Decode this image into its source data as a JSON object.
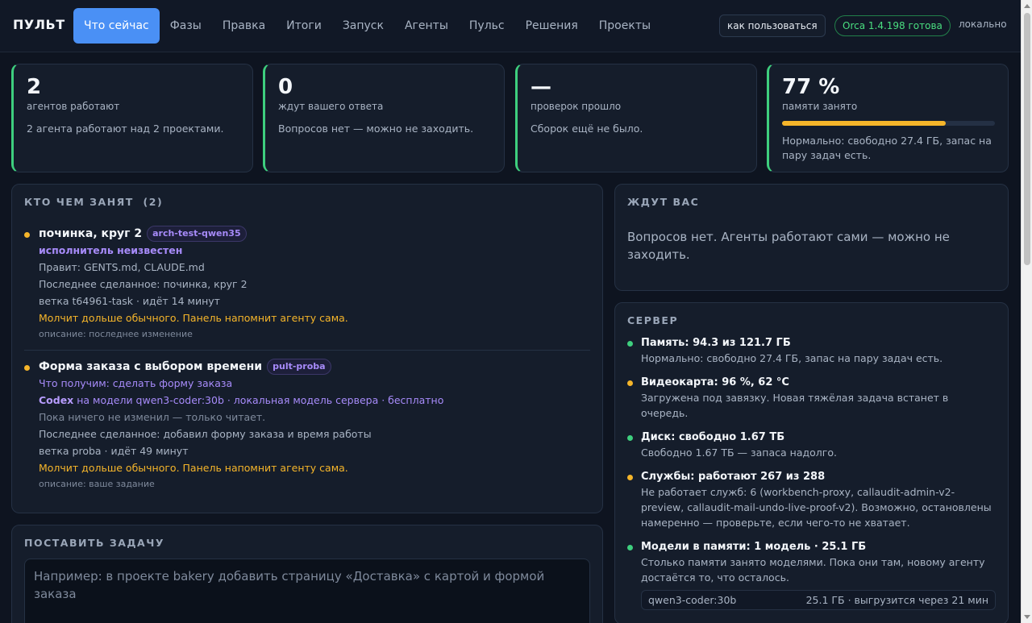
{
  "app": {
    "brand": "ПУЛЬТ"
  },
  "nav": {
    "tabs": [
      {
        "label": "Что сейчас",
        "active": true
      },
      {
        "label": "Фазы"
      },
      {
        "label": "Правка"
      },
      {
        "label": "Итоги"
      },
      {
        "label": "Запуск"
      },
      {
        "label": "Агенты"
      },
      {
        "label": "Пульс"
      },
      {
        "label": "Решения"
      },
      {
        "label": "Проекты"
      }
    ]
  },
  "header": {
    "help_label": "как пользоваться",
    "status_label": "Orca 1.4.198 готова",
    "mode_label": "локально"
  },
  "stats": [
    {
      "value": "2",
      "label": "агентов работают",
      "desc": "2 агента работают над 2 проектами."
    },
    {
      "value": "0",
      "label": "ждут вашего ответа",
      "desc": "Вопросов нет — можно не заходить."
    },
    {
      "value": "—",
      "label": "проверок прошло",
      "desc": "Сборок ещё не было."
    },
    {
      "value": "77 %",
      "label": "памяти занято",
      "fill_fraction": 0.77,
      "desc": "Нормально: свободно 27.4 ГБ, запас на пару задач есть."
    }
  ],
  "agents": {
    "title": "КТО ЧЕМ ЗАНЯТ",
    "count": "(2)",
    "items": [
      {
        "title": "починка, круг 2",
        "tag": "arch-test-qwen35",
        "executor": "исполнитель неизвестен",
        "edits": "Правит: GENTS.md, CLAUDE.md",
        "last": "Последнее сделанное: починка, круг 2",
        "branch": "ветка t64961-task · идёт 14 минут",
        "warn": "Молчит дольше обычного. Панель напомнит агенту сама.",
        "note": "описание: последнее изменение"
      },
      {
        "title": "Форма заказа с выбором времени",
        "tag": "pult-proba",
        "goal": "Что получим: сделать форму заказа",
        "model_name": "Codex",
        "model_rest": "на модели qwen3-coder:30b · локальная модель сервера · бесплатно",
        "idle": "Пока ничего не изменил — только читает.",
        "last": "Последнее сделанное: добавил форму заказа и время работы",
        "branch": "ветка proba · идёт 49 минут",
        "warn": "Молчит дольше обычного. Панель напомнит агенту сама.",
        "note": "описание: ваше задание"
      }
    ]
  },
  "waiting": {
    "title": "ЖДУТ ВАС",
    "message": "Вопросов нет. Агенты работают сами — можно не заходить."
  },
  "server": {
    "title": "СЕРВЕР",
    "items": [
      {
        "head": "Память: 94.3 из 121.7 ГБ",
        "body": "Нормально: свободно 27.4 ГБ, запас на пару задач есть.",
        "color": "#3ecf7e"
      },
      {
        "head": "Видеокарта: 96 %, 62 °C",
        "body": "Загружена под завязку. Новая тяжёлая задача встанет в очередь.",
        "color": "#f5b52a"
      },
      {
        "head": "Диск: свободно 1.67 ТБ",
        "body": "Свободно 1.67 ТБ — запаса надолго.",
        "color": "#3ecf7e"
      },
      {
        "head": "Службы: работают 267 из 288",
        "body": "Не работает служб: 6 (workbench-proxy, callaudit-admin-v2-preview, callaudit-mail-undo-live-proof-v2). Возможно, остановлены намеренно — проверьте, если чего-то не хватает.",
        "color": "#f5b52a"
      },
      {
        "head": "Модели в памяти: 1 модель · 25.1 ГБ",
        "body": "Столько памяти занято моделями. Пока они там, новому агенту достаётся то, что осталось.",
        "color": "#3ecf7e"
      }
    ],
    "model": {
      "name": "qwen3-coder:30b",
      "info": "25.1 ГБ · выгрузится через 21 мин"
    }
  },
  "task": {
    "title": "ПОСТАВИТЬ ЗАДАЧУ",
    "placeholder": "Например: в проекте bakery добавить страницу «Доставка» с картой и формой заказа"
  },
  "colors": {
    "accent": "#4a90f5",
    "ok": "#3ecf7e",
    "warn": "#f5b52a",
    "purple": "#a78bfa"
  }
}
